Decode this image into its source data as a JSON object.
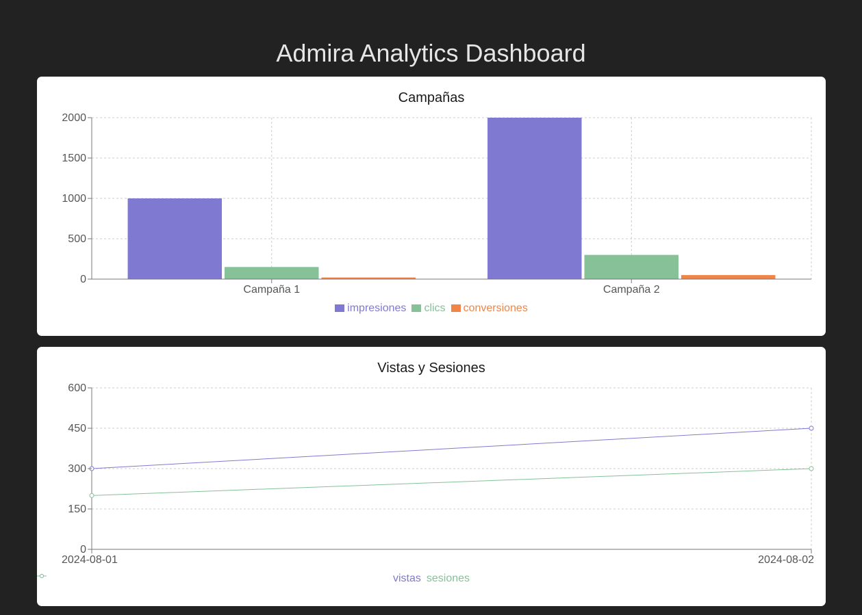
{
  "page": {
    "title": "Admira Analytics Dashboard"
  },
  "colors": {
    "background": "#222222",
    "card": "#ffffff",
    "impresiones": "#8079d1",
    "clics": "#86c198",
    "conversiones": "#f08547",
    "vistas": "#8079d1",
    "sesiones": "#86c198",
    "grid": "#cccccc",
    "axis": "#777777"
  },
  "chart_data": [
    {
      "type": "bar",
      "title": "Campañas",
      "categories": [
        "Campaña 1",
        "Campaña 2"
      ],
      "series": [
        {
          "name": "impresiones",
          "values": [
            1000,
            2000
          ],
          "color": "#8079d1"
        },
        {
          "name": "clics",
          "values": [
            150,
            300
          ],
          "color": "#86c198"
        },
        {
          "name": "conversiones",
          "values": [
            20,
            50
          ],
          "color": "#f08547"
        }
      ],
      "yticks": [
        0,
        500,
        1000,
        1500,
        2000
      ],
      "ylim": [
        0,
        2000
      ],
      "grid": true,
      "legend": "bottom-center"
    },
    {
      "type": "line",
      "title": "Vistas y Sesiones",
      "x": [
        "2024-08-01",
        "2024-08-02"
      ],
      "series": [
        {
          "name": "vistas",
          "values": [
            300,
            450
          ],
          "color": "#8079d1"
        },
        {
          "name": "sesiones",
          "values": [
            200,
            300
          ],
          "color": "#86c198"
        }
      ],
      "yticks": [
        0,
        150,
        300,
        450,
        600
      ],
      "ylim": [
        0,
        600
      ],
      "grid": true,
      "legend": "bottom-center"
    }
  ]
}
